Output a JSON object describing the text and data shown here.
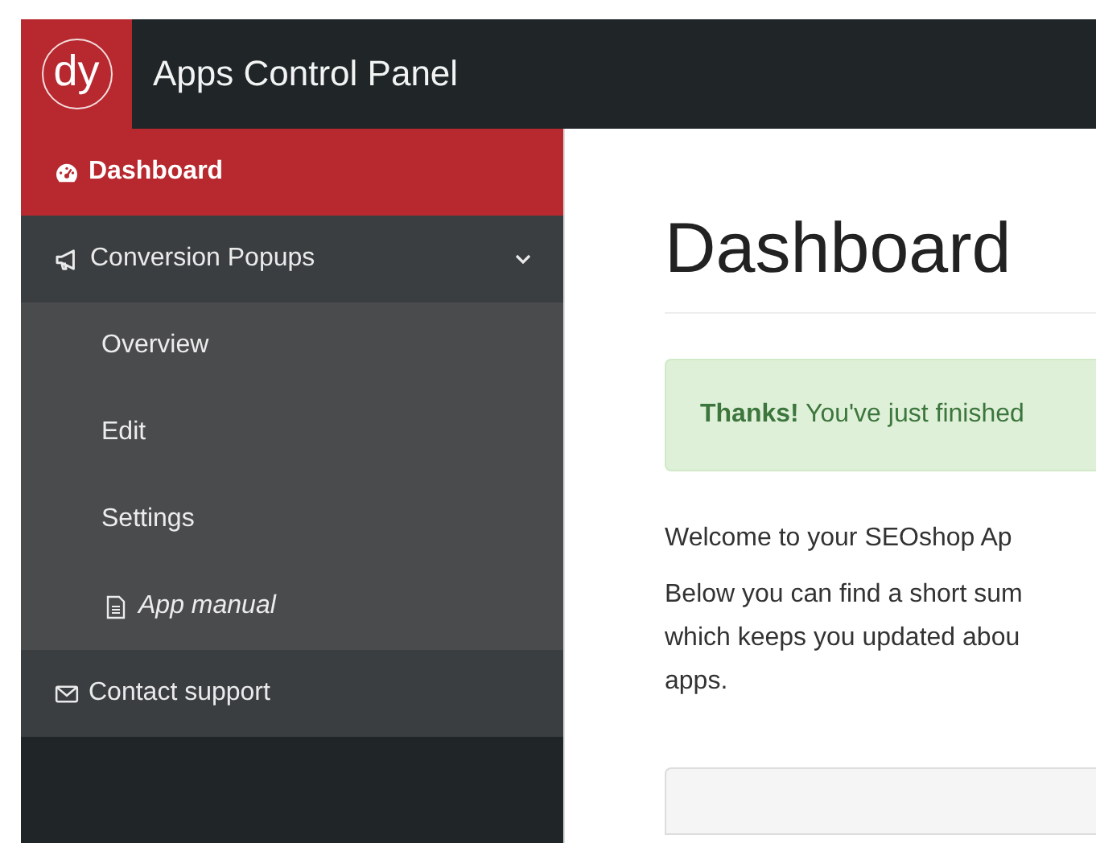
{
  "header": {
    "logo": "dy",
    "title": "Apps Control Panel"
  },
  "sidebar": {
    "items": [
      {
        "label": "Dashboard",
        "selected": true
      },
      {
        "label": "Conversion Popups",
        "selected": false,
        "expanded": true,
        "children": [
          {
            "label": "Overview",
            "kind": "link"
          },
          {
            "label": "Edit",
            "kind": "link"
          },
          {
            "label": "Settings",
            "kind": "link"
          },
          {
            "label": "App manual",
            "kind": "manual"
          }
        ]
      },
      {
        "label": "Contact support",
        "selected": false
      }
    ]
  },
  "main": {
    "title": "Dashboard",
    "alert": "**Thanks!** You've just finished",
    "paragraphs": [
      "Welcome to your SEOshop Ap",
      "Below you can find a short sum\nwhich keeps you updated abou\napps."
    ]
  }
}
